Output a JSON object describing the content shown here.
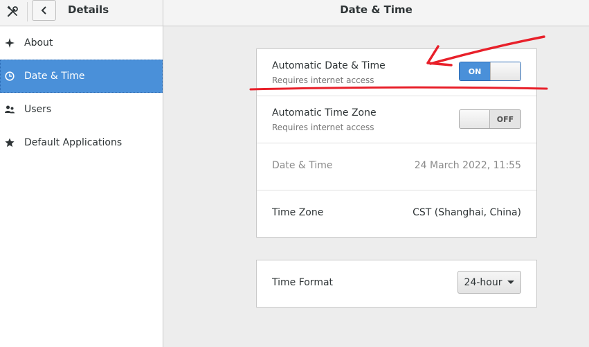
{
  "header": {
    "section_title": "Details",
    "page_title": "Date & Time"
  },
  "sidebar": {
    "items": [
      {
        "label": "About",
        "icon": "sparkle-icon"
      },
      {
        "label": "Date & Time",
        "icon": "clock-icon",
        "active": true
      },
      {
        "label": "Users",
        "icon": "users-icon"
      },
      {
        "label": "Default Applications",
        "icon": "star-icon"
      }
    ]
  },
  "datetime_panel": {
    "auto_datetime": {
      "title": "Automatic Date & Time",
      "subtitle": "Requires internet access",
      "switch_label": "ON",
      "state": true
    },
    "auto_timezone": {
      "title": "Automatic Time Zone",
      "subtitle": "Requires internet access",
      "switch_label": "OFF",
      "state": false
    },
    "date_time": {
      "title": "Date & Time",
      "value": "24 March 2022, 11:55"
    },
    "time_zone": {
      "title": "Time Zone",
      "value": "CST (Shanghai, China)"
    }
  },
  "format_panel": {
    "time_format": {
      "title": "Time Format",
      "value": "24-hour"
    }
  },
  "colors": {
    "accent": "#4a90d9",
    "annotation": "#e8202a"
  }
}
